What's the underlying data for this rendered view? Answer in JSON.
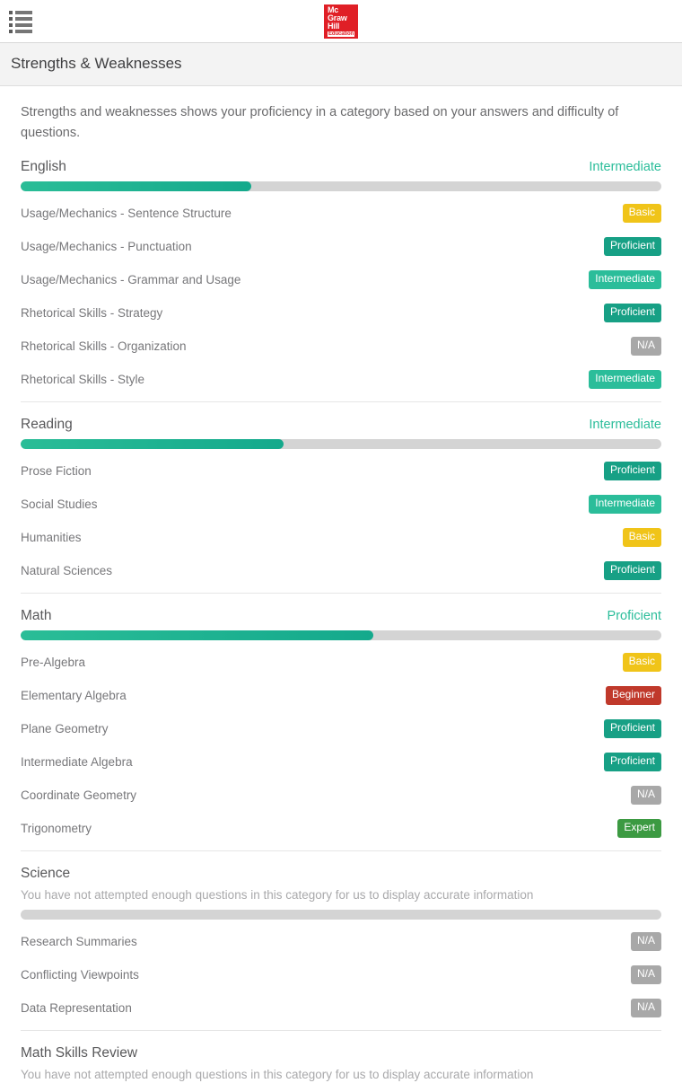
{
  "header": {
    "menu_icon": "list-menu-icon",
    "brand": {
      "line1": "Mc",
      "line2": "Graw",
      "line3": "Hill",
      "line4": "Education",
      "color": "#e01f26"
    }
  },
  "page": {
    "title": "Strengths & Weaknesses",
    "intro": "Strengths and weaknesses shows your proficiency in a category based on your answers and difficulty of questions."
  },
  "colors": {
    "accent_green": "#2bbd9a",
    "proficient": "#17a085",
    "intermediate": "#2bbd9a",
    "basic": "#f0c419",
    "beginner": "#c0392b",
    "expert": "#3c9a42",
    "na": "#a8a8a8",
    "track": "#d4d4d4"
  },
  "not_enough_data_note": "You have not attempted enough questions in this category for us to display accurate information",
  "sections": [
    {
      "name": "English",
      "level": "Intermediate",
      "progress_percent": 36,
      "has_data": true,
      "items": [
        {
          "label": "Usage/Mechanics - Sentence Structure",
          "badge": "Basic",
          "badge_class": "basic"
        },
        {
          "label": "Usage/Mechanics - Punctuation",
          "badge": "Proficient",
          "badge_class": "proficient"
        },
        {
          "label": "Usage/Mechanics - Grammar and Usage",
          "badge": "Intermediate",
          "badge_class": "intermediate"
        },
        {
          "label": "Rhetorical Skills - Strategy",
          "badge": "Proficient",
          "badge_class": "proficient"
        },
        {
          "label": "Rhetorical Skills - Organization",
          "badge": "N/A",
          "badge_class": "na"
        },
        {
          "label": "Rhetorical Skills - Style",
          "badge": "Intermediate",
          "badge_class": "intermediate"
        }
      ]
    },
    {
      "name": "Reading",
      "level": "Intermediate",
      "progress_percent": 41,
      "has_data": true,
      "items": [
        {
          "label": "Prose Fiction",
          "badge": "Proficient",
          "badge_class": "proficient"
        },
        {
          "label": "Social Studies",
          "badge": "Intermediate",
          "badge_class": "intermediate"
        },
        {
          "label": "Humanities",
          "badge": "Basic",
          "badge_class": "basic"
        },
        {
          "label": "Natural Sciences",
          "badge": "Proficient",
          "badge_class": "proficient"
        }
      ]
    },
    {
      "name": "Math",
      "level": "Proficient",
      "progress_percent": 55,
      "has_data": true,
      "items": [
        {
          "label": "Pre-Algebra",
          "badge": "Basic",
          "badge_class": "basic"
        },
        {
          "label": "Elementary Algebra",
          "badge": "Beginner",
          "badge_class": "beginner"
        },
        {
          "label": "Plane Geometry",
          "badge": "Proficient",
          "badge_class": "proficient"
        },
        {
          "label": "Intermediate Algebra",
          "badge": "Proficient",
          "badge_class": "proficient"
        },
        {
          "label": "Coordinate Geometry",
          "badge": "N/A",
          "badge_class": "na"
        },
        {
          "label": "Trigonometry",
          "badge": "Expert",
          "badge_class": "expert"
        }
      ]
    },
    {
      "name": "Science",
      "level": "",
      "progress_percent": 0,
      "has_data": false,
      "note": "You have not attempted enough questions in this category for us to display accurate information",
      "items": [
        {
          "label": "Research Summaries",
          "badge": "N/A",
          "badge_class": "na"
        },
        {
          "label": "Conflicting Viewpoints",
          "badge": "N/A",
          "badge_class": "na"
        },
        {
          "label": "Data Representation",
          "badge": "N/A",
          "badge_class": "na"
        }
      ]
    },
    {
      "name": "Math Skills Review",
      "level": "",
      "progress_percent": 0,
      "has_data": false,
      "note": "You have not attempted enough questions in this category for us to display accurate information",
      "items": []
    }
  ]
}
